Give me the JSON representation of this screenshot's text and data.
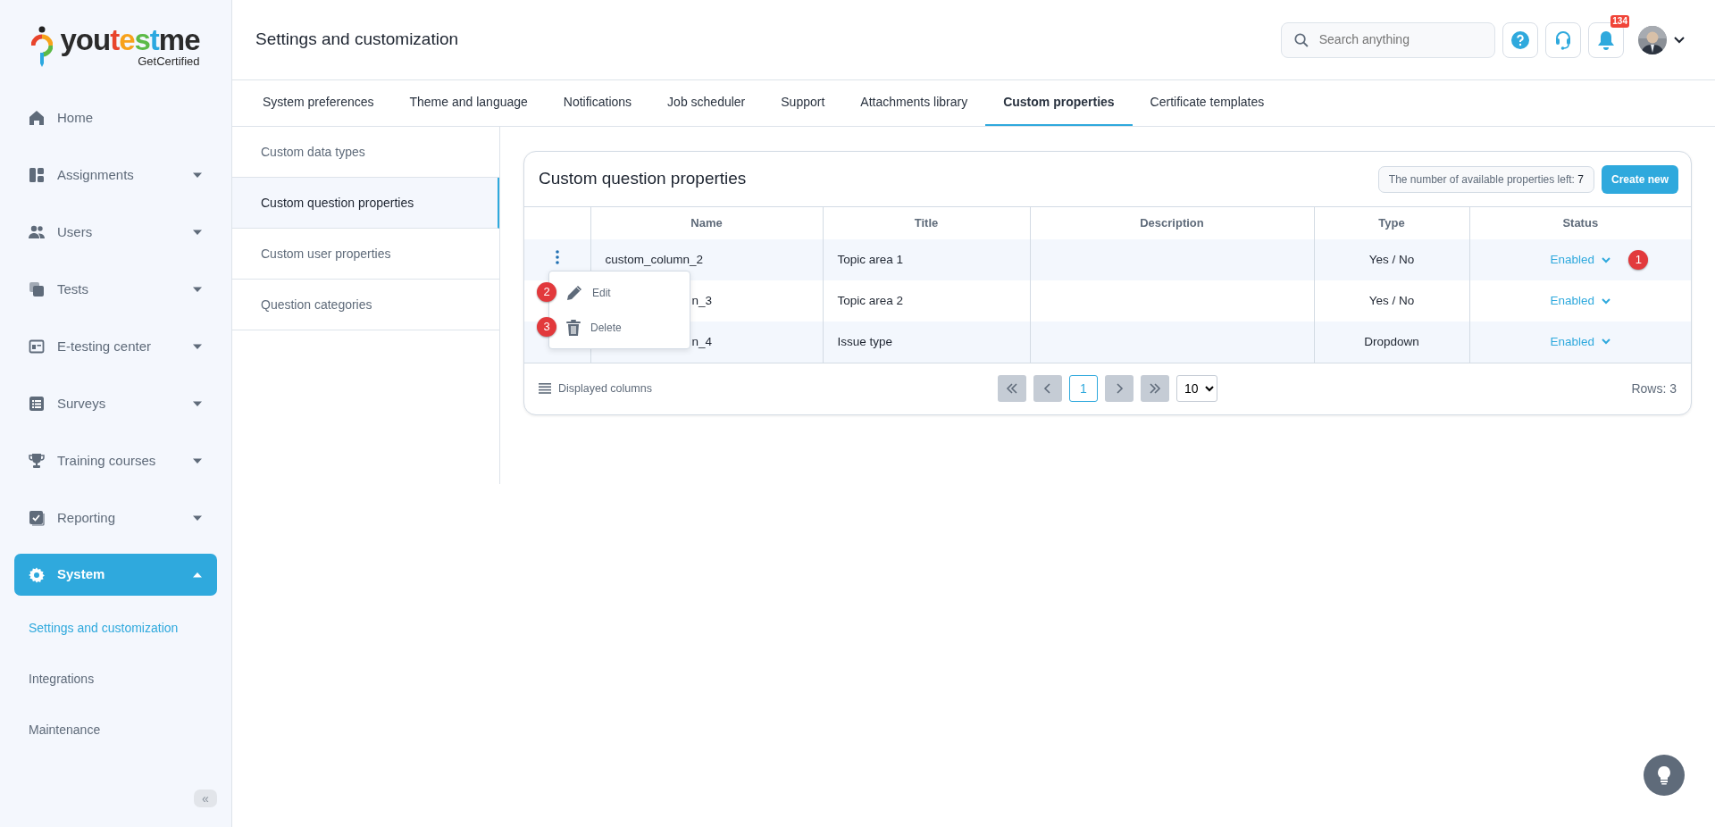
{
  "logo": {
    "parts": [
      {
        "text": "you",
        "color": "#2b2b2b"
      },
      {
        "text": "t",
        "color": "#e8442c"
      },
      {
        "text": "e",
        "color": "#f7a21b"
      },
      {
        "text": "s",
        "color": "#5cba47"
      },
      {
        "text": "t",
        "color": "#2ba8e0"
      },
      {
        "text": "me",
        "color": "#2b2b2b"
      }
    ],
    "tagline": "GetCertified"
  },
  "sidebar": {
    "items": [
      {
        "label": "Home",
        "selected": false
      },
      {
        "label": "Assignments",
        "expanded": false,
        "selected": false
      },
      {
        "label": "Users",
        "expanded": false,
        "selected": false
      },
      {
        "label": "Tests",
        "expanded": false,
        "selected": false
      },
      {
        "label": "E-testing center",
        "expanded": false,
        "selected": false
      },
      {
        "label": "Surveys",
        "expanded": false,
        "selected": false
      },
      {
        "label": "Training courses",
        "expanded": false,
        "selected": false
      },
      {
        "label": "Reporting",
        "expanded": false,
        "selected": false
      },
      {
        "label": "System",
        "expanded": true,
        "selected": true,
        "children": [
          {
            "label": "Settings and customization",
            "selected": true
          },
          {
            "label": "Integrations",
            "selected": false
          },
          {
            "label": "Maintenance",
            "selected": false
          }
        ]
      }
    ],
    "collapse_button": "«"
  },
  "header": {
    "title": "Settings and customization",
    "search": {
      "placeholder": "Search anything"
    },
    "notification_count": "134"
  },
  "tabs": [
    {
      "label": "System preferences",
      "selected": false
    },
    {
      "label": "Theme and language",
      "selected": false
    },
    {
      "label": "Notifications",
      "selected": false
    },
    {
      "label": "Job scheduler",
      "selected": false
    },
    {
      "label": "Support",
      "selected": false
    },
    {
      "label": "Attachments library",
      "selected": false
    },
    {
      "label": "Custom properties",
      "selected": true
    },
    {
      "label": "Certificate templates",
      "selected": false
    }
  ],
  "subnav": [
    {
      "label": "Custom data types",
      "selected": false
    },
    {
      "label": "Custom question properties",
      "selected": true
    },
    {
      "label": "Custom user properties",
      "selected": false
    },
    {
      "label": "Question categories",
      "selected": false
    }
  ],
  "card": {
    "title": "Custom question properties",
    "counter_label": "The number of available properties left:",
    "counter_value": "7",
    "create_button": "Create new"
  },
  "table": {
    "columns": [
      "Name",
      "Title",
      "Description",
      "Type",
      "Status"
    ],
    "rows": [
      {
        "name": "custom_column_2",
        "title": "Topic area 1",
        "type": "Yes / No",
        "status": "Enabled",
        "name_partly_hidden": false,
        "marker": "1"
      },
      {
        "name": "n_3",
        "title": "Topic area 2",
        "type": "Yes / No",
        "status": "Enabled",
        "name_partly_hidden": true
      },
      {
        "name": "n_4",
        "title": "Issue type",
        "type": "Dropdown",
        "status": "Enabled",
        "name_partly_hidden": true
      }
    ]
  },
  "row_menu": {
    "items": [
      {
        "label": "Edit",
        "marker": "2"
      },
      {
        "label": "Delete",
        "marker": "3"
      }
    ]
  },
  "footer": {
    "displayed_columns": "Displayed columns",
    "pages": [
      {
        "label": "1",
        "selected": true
      }
    ],
    "page_size": "10",
    "rows_count": "Rows: 3"
  }
}
